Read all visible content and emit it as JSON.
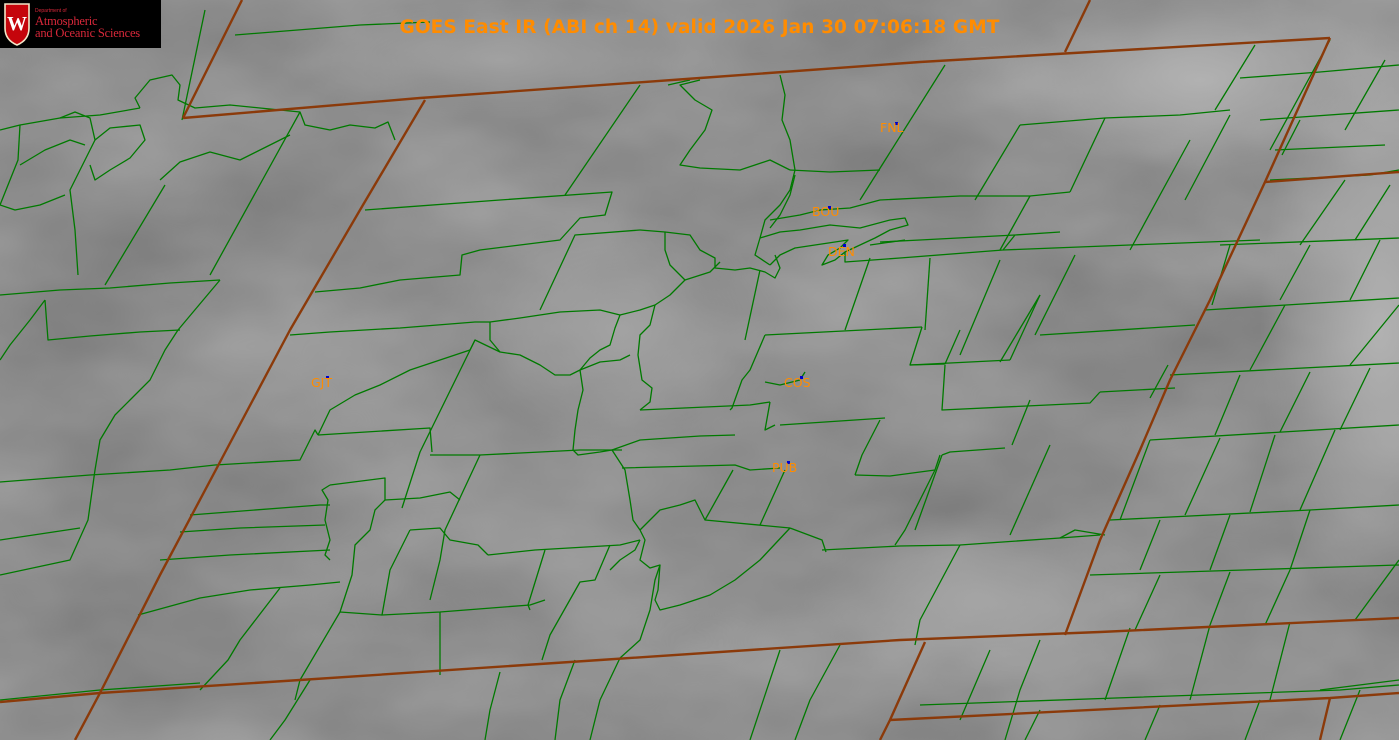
{
  "logo": {
    "department_line": "Department of",
    "line1": "Atmospheric",
    "line2": "and Oceanic Sciences",
    "crest_letter": "W",
    "crest_color": "#c5050c"
  },
  "title": "GOES East IR (ABI ch 14) valid 2026 Jan 30 07:06:18 GMT",
  "colors": {
    "background": "#7b7b7b",
    "county_lines": "#007a00",
    "state_lines": "#8b3a0a",
    "labels": "#ff8c00",
    "station_marker": "#0000cc"
  },
  "stations": [
    {
      "id": "FNL"
    },
    {
      "id": "BOU"
    },
    {
      "id": "DEN"
    },
    {
      "id": "GJT"
    },
    {
      "id": "COS"
    },
    {
      "id": "PUB"
    }
  ]
}
